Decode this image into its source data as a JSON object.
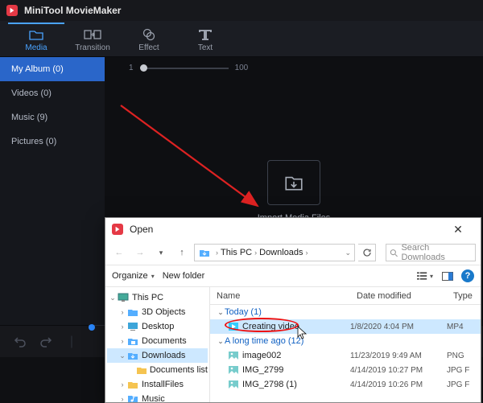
{
  "app": {
    "title": "MiniTool MovieMaker"
  },
  "toolbar": [
    {
      "label": "Media",
      "icon": "folder-icon",
      "active": true
    },
    {
      "label": "Transition",
      "icon": "transition-icon",
      "active": false
    },
    {
      "label": "Effect",
      "icon": "effect-icon",
      "active": false
    },
    {
      "label": "Text",
      "icon": "text-icon",
      "active": false
    }
  ],
  "sidebar": [
    {
      "label": "My Album  (0)",
      "active": true
    },
    {
      "label": "Videos  (0)",
      "active": false
    },
    {
      "label": "Music  (9)",
      "active": false
    },
    {
      "label": "Pictures  (0)",
      "active": false
    }
  ],
  "stage": {
    "slider_min": "1",
    "slider_max": "100",
    "import_label": "Import Media Files"
  },
  "dialog": {
    "title": "Open",
    "breadcrumb": [
      "This PC",
      "Downloads"
    ],
    "search_placeholder": "Search Downloads",
    "organize": "Organize",
    "new_folder": "New folder",
    "columns": {
      "name": "Name",
      "date": "Date modified",
      "type": "Type"
    },
    "tree": [
      {
        "label": "This PC",
        "depth": 0,
        "expanded": true,
        "icon": "pc"
      },
      {
        "label": "3D Objects",
        "depth": 1,
        "icon": "folder-blue"
      },
      {
        "label": "Desktop",
        "depth": 1,
        "icon": "desktop"
      },
      {
        "label": "Documents",
        "depth": 1,
        "icon": "folder-doc"
      },
      {
        "label": "Downloads",
        "depth": 1,
        "expanded": true,
        "selected": true,
        "icon": "downloads"
      },
      {
        "label": "Documents list",
        "depth": 2,
        "icon": "folder-yellow"
      },
      {
        "label": "InstallFiles",
        "depth": 1,
        "icon": "folder-yellow"
      },
      {
        "label": "Music",
        "depth": 1,
        "icon": "music"
      }
    ],
    "groups": [
      {
        "label": "Today (1)",
        "items": [
          {
            "name": "Creating video",
            "date": "1/8/2020 4:04 PM",
            "type": "MP4",
            "selected": true,
            "highlighted": true,
            "icon": "video"
          }
        ]
      },
      {
        "label": "A long time ago (12)",
        "items": [
          {
            "name": "image002",
            "date": "11/23/2019 9:49 AM",
            "type": "PNG",
            "icon": "image"
          },
          {
            "name": "IMG_2799",
            "date": "4/14/2019 10:27 PM",
            "type": "JPG F",
            "icon": "image"
          },
          {
            "name": "IMG_2798 (1)",
            "date": "4/14/2019 10:26 PM",
            "type": "JPG F",
            "icon": "image"
          }
        ]
      }
    ]
  }
}
